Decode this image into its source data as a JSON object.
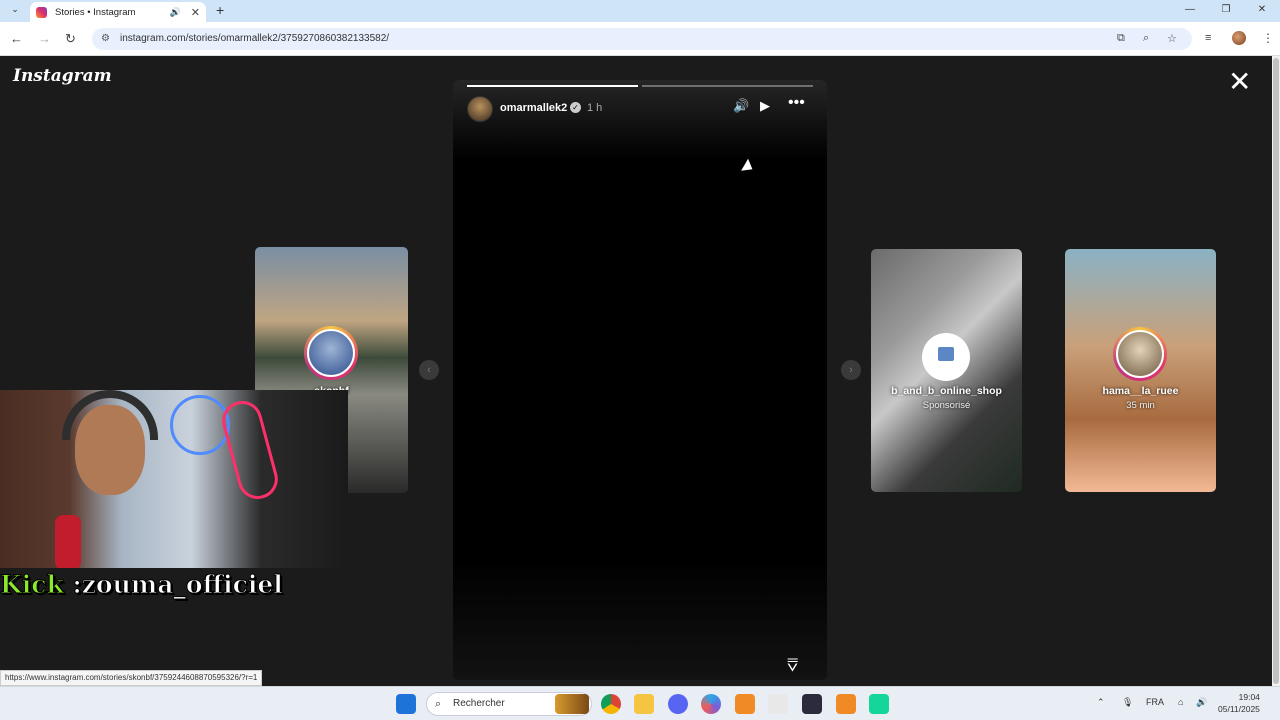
{
  "browser": {
    "tab_title": "Stories • Instagram",
    "url": "instagram.com/stories/omarmallek2/3759270860382133582/",
    "status_url": "https://www.instagram.com/stories/skonbf/3759244608870595326/?r=1"
  },
  "instagram": {
    "logo": "Instagram",
    "close_icon": "close-icon",
    "current_story": {
      "username": "omarmallek2",
      "time": "1 h",
      "progress_segments": [
        1,
        0
      ]
    },
    "side_stories": [
      {
        "username": "skonbf",
        "subtitle": ""
      },
      {
        "username": "b_and_b_online_shop",
        "subtitle": "Sponsorisé"
      },
      {
        "username": "hama__la_ruee",
        "subtitle": "35 min"
      }
    ]
  },
  "overlay": {
    "kick_prefix": "Kick",
    "kick_handle": " :zouma_officiel"
  },
  "taskbar": {
    "search_placeholder": "Rechercher",
    "lang": "FRA",
    "time": "19:04",
    "date": "05/11/2025"
  }
}
